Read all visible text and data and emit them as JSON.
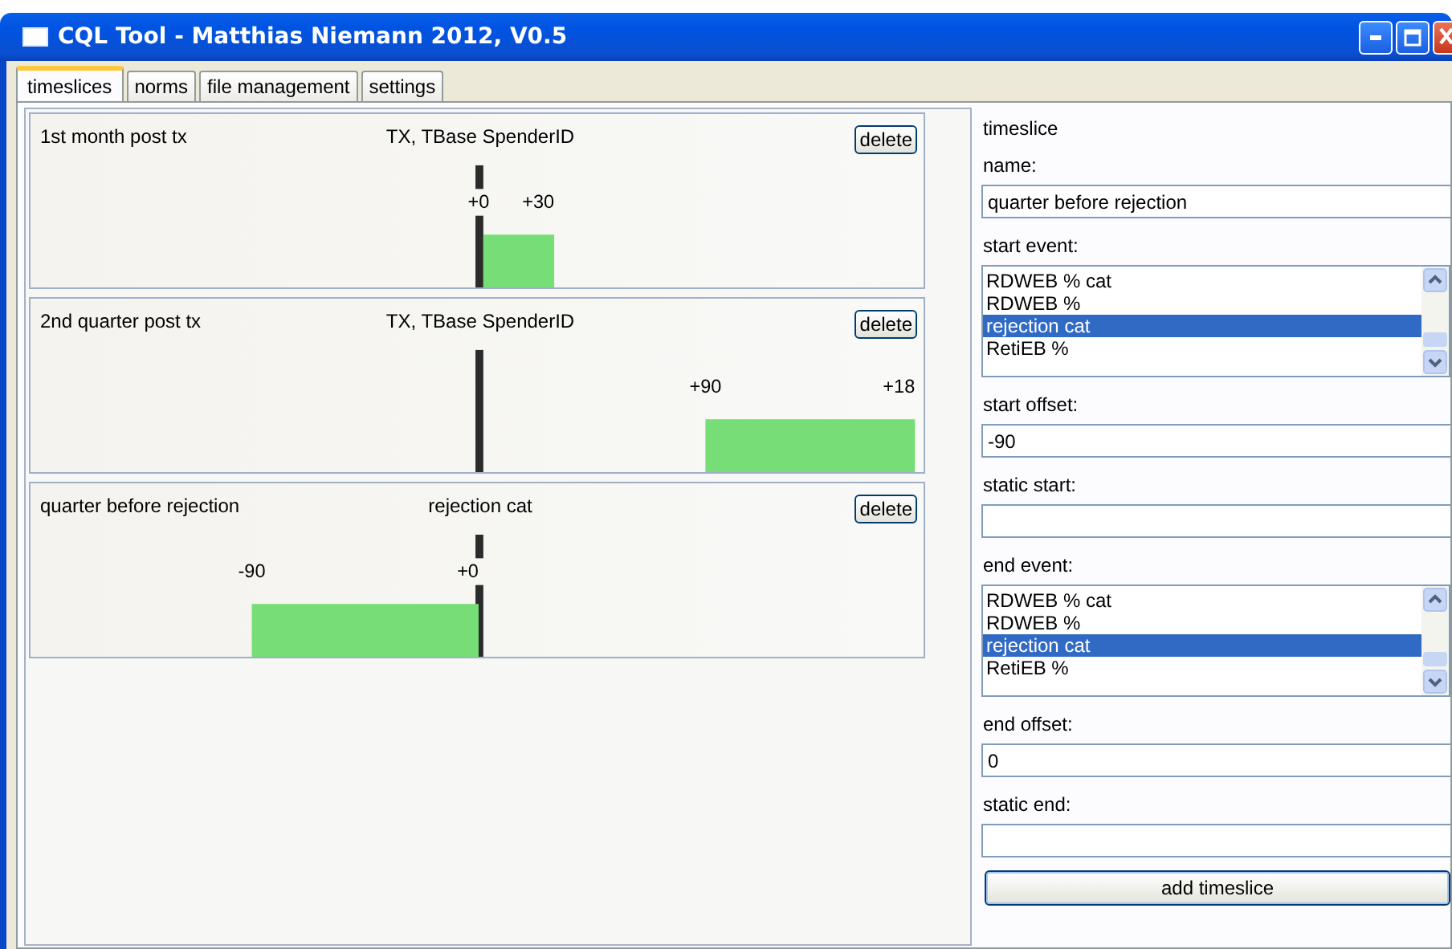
{
  "window": {
    "title": "CQL Tool - Matthias Niemann 2012, V0.5"
  },
  "tabs": [
    {
      "label": "timeslices",
      "selected": true
    },
    {
      "label": "norms",
      "selected": false
    },
    {
      "label": "file management",
      "selected": false
    },
    {
      "label": "settings",
      "selected": false
    }
  ],
  "timeslices": [
    {
      "name": "1st month post tx",
      "event": "TX, TBase SpenderID",
      "start_label": "+0",
      "end_label": "+30",
      "delete_label": "delete"
    },
    {
      "name": "2nd quarter post tx",
      "event": "TX, TBase SpenderID",
      "start_label": "+90",
      "end_label": "+18",
      "delete_label": "delete"
    },
    {
      "name": "quarter before rejection",
      "event": "rejection cat",
      "start_label": "-90",
      "end_label": "+0",
      "delete_label": "delete"
    }
  ],
  "editor": {
    "heading": "timeslice",
    "fields": [
      {
        "kind": "text",
        "label": "name:",
        "value": "quarter before rejection"
      },
      {
        "kind": "list",
        "label": "start event:",
        "items": [
          {
            "text": "RDWEB % cat",
            "selected": false
          },
          {
            "text": "RDWEB %",
            "selected": false
          },
          {
            "text": "rejection cat",
            "selected": true
          },
          {
            "text": "RetiEB %",
            "selected": false
          }
        ]
      },
      {
        "kind": "text",
        "label": "start offset:",
        "value": "-90"
      },
      {
        "kind": "text",
        "label": "static start:"
      },
      {
        "kind": "list",
        "label": "end event:",
        "items": [
          {
            "text": "RDWEB % cat",
            "selected": false
          },
          {
            "text": "RDWEB %",
            "selected": false
          },
          {
            "text": "rejection cat",
            "selected": true
          },
          {
            "text": "RetiEB %",
            "selected": false
          }
        ]
      },
      {
        "kind": "text",
        "label": "end offset:",
        "value": "0"
      },
      {
        "kind": "text",
        "label": "static end:"
      }
    ],
    "button": "add timeslice"
  }
}
